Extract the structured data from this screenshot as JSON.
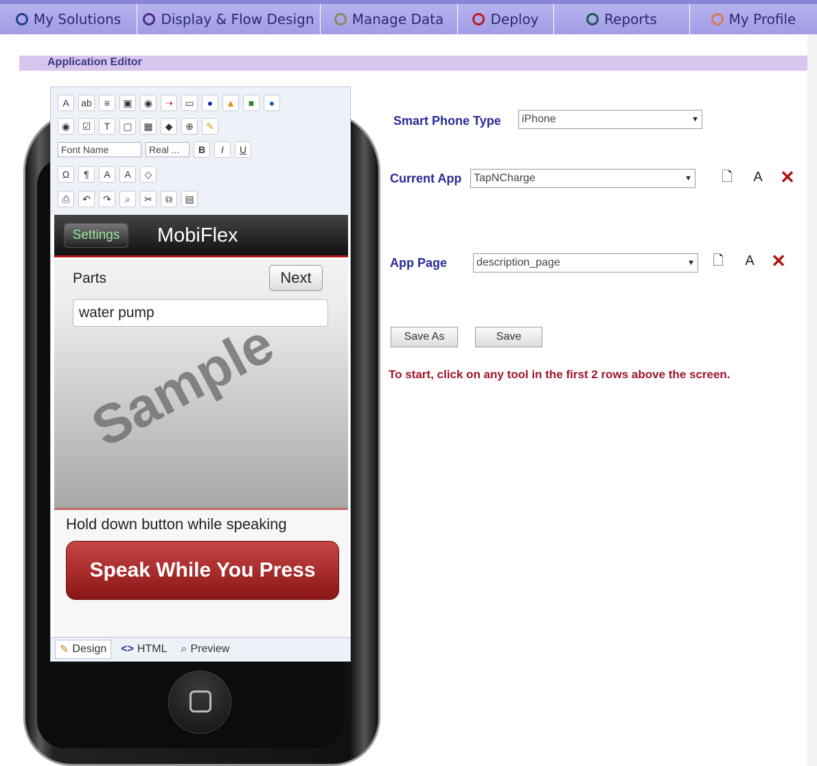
{
  "nav": {
    "tabs": [
      {
        "label": "My Solutions",
        "icon": "ring-icon",
        "color": "#1f3f8f"
      },
      {
        "label": "Display & Flow Design",
        "icon": "ring-icon",
        "color": "#4a2a8a"
      },
      {
        "label": "Manage Data",
        "icon": "ring-icon",
        "color": "#8a8a5a"
      },
      {
        "label": "Deploy",
        "icon": "ring-icon",
        "color": "#c01818"
      },
      {
        "label": "Reports",
        "icon": "ring-icon",
        "color": "#1a5a4a"
      },
      {
        "label": "My Profile",
        "icon": "ring-icon",
        "color": "#d87a50"
      }
    ]
  },
  "editor": {
    "header": "Application Editor",
    "toolbar": {
      "font_name": "Font Name",
      "font_size": "Real ..."
    },
    "tabs": [
      {
        "label": "Design",
        "icon": "pencil-icon"
      },
      {
        "label": "HTML",
        "icon": "code-icon"
      },
      {
        "label": "Preview",
        "icon": "magnifier-icon"
      }
    ]
  },
  "app": {
    "settings_label": "Settings",
    "title": "MobiFlex",
    "parts_label": "Parts",
    "next_label": "Next",
    "parts_value": "water pump",
    "watermark": "Sample",
    "hold_text": "Hold down button while speaking",
    "speak_label": "Speak While You Press"
  },
  "form": {
    "phone_type_label": "Smart Phone Type",
    "phone_type_value": "iPhone",
    "current_app_label": "Current App",
    "current_app_value": "TapNCharge",
    "app_page_label": "App Page",
    "app_page_value": "description_page",
    "save_as_label": "Save As",
    "save_label": "Save",
    "hint": "To start, click on any tool in the first 2 rows above the screen."
  }
}
